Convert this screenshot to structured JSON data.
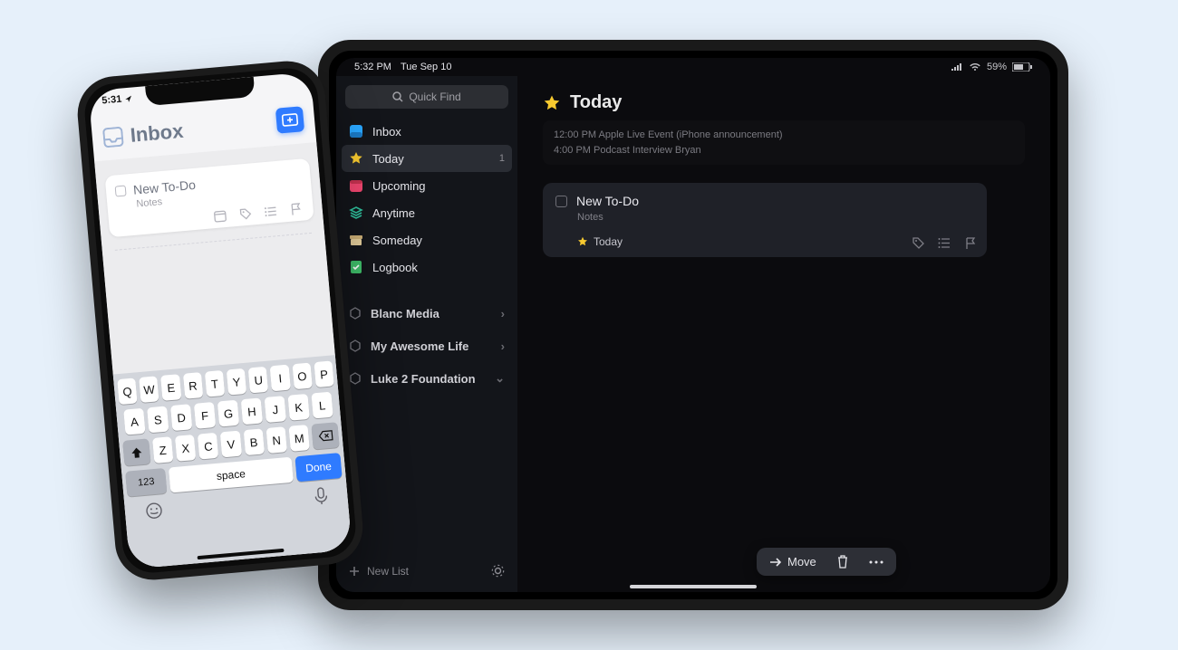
{
  "ipad": {
    "status_time": "5:32 PM",
    "status_date": "Tue Sep 10",
    "status_battery": "59%",
    "quick_find": "Quick Find",
    "sidebar": [
      {
        "icon": "inbox-icon",
        "label": "Inbox",
        "badge": ""
      },
      {
        "icon": "star-icon",
        "label": "Today",
        "badge": "1",
        "selected": true
      },
      {
        "icon": "calendar-icon",
        "label": "Upcoming"
      },
      {
        "icon": "layers-icon",
        "label": "Anytime"
      },
      {
        "icon": "archive-icon",
        "label": "Someday"
      },
      {
        "icon": "logbook-icon",
        "label": "Logbook"
      }
    ],
    "areas": [
      "Blanc Media",
      "My Awesome Life",
      "Luke 2 Foundation"
    ],
    "new_list": "New List",
    "title": "Today",
    "events": [
      "12:00 PM Apple Live Event (iPhone announcement)",
      "4:00 PM Podcast Interview Bryan"
    ],
    "card": {
      "title": "New To-Do",
      "notes": "Notes",
      "when": "Today"
    },
    "toolbar": {
      "move": "Move"
    }
  },
  "iphone": {
    "status_time": "5:31",
    "title": "Inbox",
    "card": {
      "title": "New To-Do",
      "notes": "Notes"
    },
    "keyboard": {
      "row1": [
        "Q",
        "W",
        "E",
        "R",
        "T",
        "Y",
        "U",
        "I",
        "O",
        "P"
      ],
      "row2": [
        "A",
        "S",
        "D",
        "F",
        "G",
        "H",
        "J",
        "K",
        "L"
      ],
      "row3": [
        "Z",
        "X",
        "C",
        "V",
        "B",
        "N",
        "M"
      ],
      "n123": "123",
      "space": "space",
      "done": "Done"
    }
  }
}
